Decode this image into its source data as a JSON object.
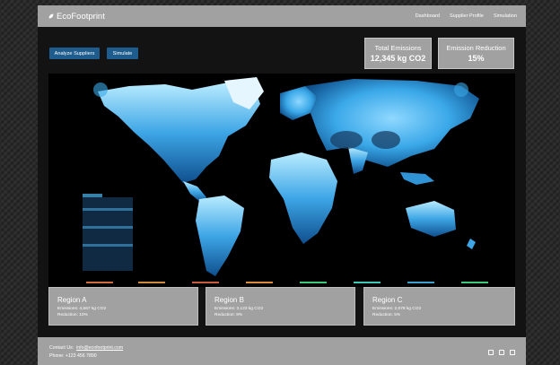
{
  "brand": {
    "name": "EcoFootprint",
    "icon": "leaf-icon"
  },
  "nav": {
    "items": [
      "Dashboard",
      "Supplier Profile",
      "Simulation"
    ]
  },
  "actions": {
    "analyze_label": "Analyze Suppliers",
    "simulate_label": "Simulate"
  },
  "stats": {
    "total": {
      "label": "Total Emissions",
      "value": "12,345 kg CO2"
    },
    "reduction": {
      "label": "Emission Reduction",
      "value": "15%"
    }
  },
  "regions": [
    {
      "name": "Region A",
      "emissions": "Emissions: 4,567 kg CO2",
      "reduction": "Reduction: 10%"
    },
    {
      "name": "Region B",
      "emissions": "Emissions: 3,123 kg CO2",
      "reduction": "Reduction: 8%"
    },
    {
      "name": "Region C",
      "emissions": "Emissions: 2,678 kg CO2",
      "reduction": "Reduction: 5%"
    }
  ],
  "footer": {
    "contact_label": "Contact Us:",
    "email": "info@ecofootprint.com",
    "phone": "Phone: +123 456 7890",
    "social_icons": [
      "facebook-icon",
      "twitter-icon",
      "linkedin-icon"
    ]
  },
  "colors": {
    "accent": "#1e5c8e",
    "panel": "#a1a1a1",
    "map_glow": "#3aa8e8"
  }
}
